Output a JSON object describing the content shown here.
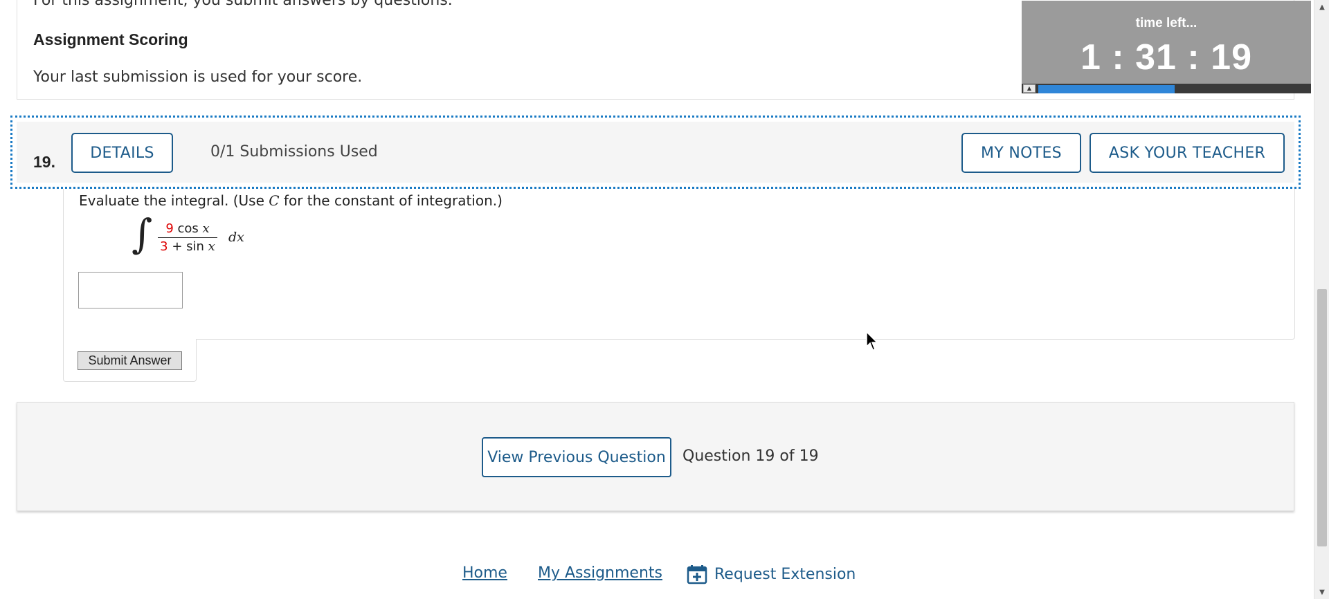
{
  "intro": {
    "cut_text": "For this assignment, you submit answers by questions.",
    "scoring_title": "Assignment Scoring",
    "scoring_text": "Your last submission is used for your score."
  },
  "timer": {
    "label": "time left...",
    "value": "1 : 31 : 19",
    "scroll_arrow": "▲",
    "progress_fraction": 0.5
  },
  "question": {
    "number": "19.",
    "details_label": "DETAILS",
    "submissions_text": "0/1 Submissions Used",
    "my_notes_label": "MY NOTES",
    "ask_teacher_label": "ASK YOUR TEACHER",
    "prompt_before": "Evaluate the integral. (Use ",
    "prompt_var": "C",
    "prompt_after": " for the constant of integration.)",
    "integral": {
      "sign": "∫",
      "num_coef": "9",
      "num_func": "cos",
      "num_var": "x",
      "den_coef": "3",
      "den_rest": "+ sin",
      "den_var": "x",
      "dx": "dx"
    },
    "answer_value": "",
    "submit_label": "Submit Answer"
  },
  "navigation": {
    "prev_label": "View Previous Question",
    "position_text": "Question 19 of 19"
  },
  "footer": {
    "home": "Home",
    "my_assignments": "My Assignments",
    "request_extension": "Request Extension"
  },
  "scrollbar": {
    "up_arrow": "▲",
    "down_arrow": "▼"
  },
  "colors": {
    "link_blue": "#1d5b8a",
    "focus_dotted": "#1a7ac4",
    "timer_bg": "#9b9b9b",
    "timer_fill": "#2f86d8",
    "math_red": "#dd0000"
  }
}
